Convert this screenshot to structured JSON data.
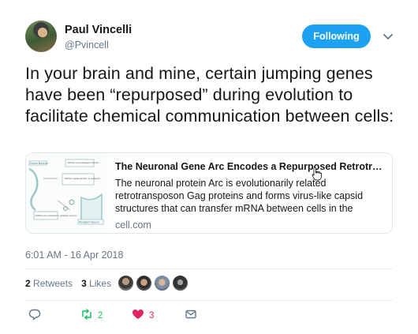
{
  "user": {
    "name": "Paul Vincelli",
    "handle": "@Pvincell",
    "follow_label": "Following"
  },
  "tweet": {
    "text": "In your brain and mine, certain jumping genes have been “repurposed” during evolution to facilitate chemical communication between cells:",
    "timestamp": "6:01 AM - 16 Apr 2018"
  },
  "card": {
    "title": "The Neuronal Gene Arc Encodes a Repurposed Retrotrans...",
    "description": "The neuronal protein Arc is evolutionarily related retrotransposon Gag proteins and forms virus-like capsid structures that can transfer mRNA between cells in the nervou...",
    "domain": "cell.com",
    "thumb_labels": {
      "donor": "Donor Neuron",
      "recipient": "Recipient Neuron",
      "box1": "mRNAs are packaged into Arc...",
      "box2": "mRNAs signal transfer to recipient...",
      "box3": "mRNAs are released in recipient neuron"
    }
  },
  "stats": {
    "retweets_count": "2",
    "retweets_label": "Retweets",
    "likes_count": "3",
    "likes_label": "Likes"
  },
  "actions": {
    "retweet_count": "2",
    "like_count": "3"
  },
  "colors": {
    "accent": "#1da1f2",
    "retweet": "#17bf63",
    "like": "#e0245e",
    "muted": "#657786"
  }
}
